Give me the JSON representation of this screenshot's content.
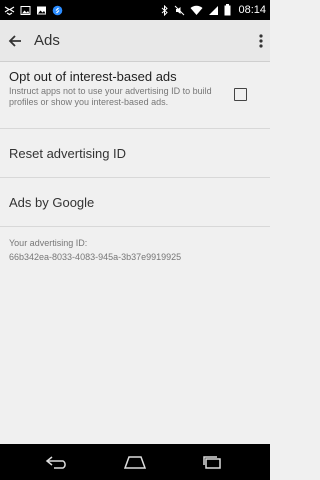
{
  "status_bar": {
    "time": "08:14",
    "left_icons": [
      "dropbox-icon",
      "image-icon",
      "photo-icon",
      "shazam-icon"
    ],
    "right_icons": [
      "bluetooth-icon",
      "mute-icon",
      "wifi-icon",
      "signal-icon",
      "battery-icon"
    ]
  },
  "action_bar": {
    "title": "Ads"
  },
  "preferences": {
    "opt_out": {
      "title": "Opt out of interest-based ads",
      "summary": "Instruct apps not to use your advertising ID to build profiles or show you interest-based ads.",
      "checked": false
    },
    "reset": {
      "title": "Reset advertising ID"
    },
    "ads_by_google": {
      "title": "Ads by Google"
    },
    "advertising_id": {
      "label": "Your advertising ID:",
      "value": "66b342ea-8033-4083-945a-3b37e9919925"
    }
  },
  "nav_bar": {
    "buttons": [
      "back-icon",
      "home-icon",
      "recents-icon"
    ]
  },
  "colors": {
    "background": "#f0f0f0",
    "action_bar": "#e8e8e8",
    "status_bar": "#000000"
  }
}
